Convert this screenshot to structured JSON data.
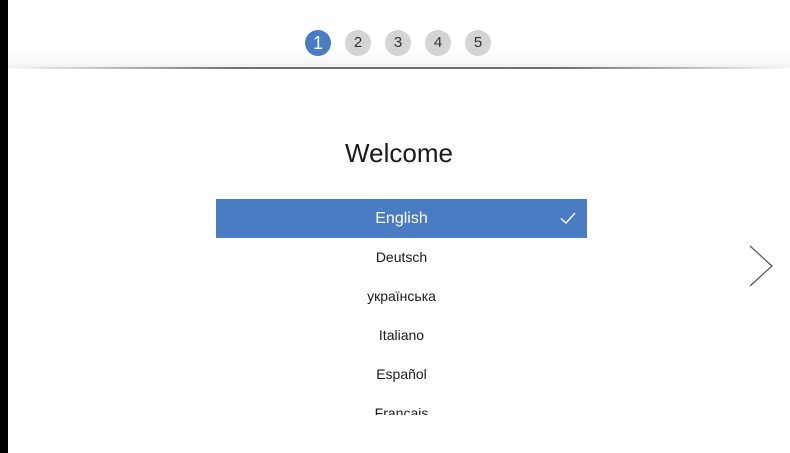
{
  "steps": [
    "1",
    "2",
    "3",
    "4",
    "5"
  ],
  "active_step": "1",
  "title": "Welcome",
  "languages": [
    {
      "label": "English",
      "selected": true
    },
    {
      "label": "Deutsch",
      "selected": false
    },
    {
      "label": "українська",
      "selected": false
    },
    {
      "label": "Italiano",
      "selected": false
    },
    {
      "label": "Español",
      "selected": false
    },
    {
      "label": "Français",
      "selected": false
    }
  ],
  "icons": {
    "check": "checkmark-icon",
    "next": "chevron-right-icon"
  },
  "colors": {
    "accent": "#4a7cc4",
    "step_inactive": "#d4d4d4"
  }
}
